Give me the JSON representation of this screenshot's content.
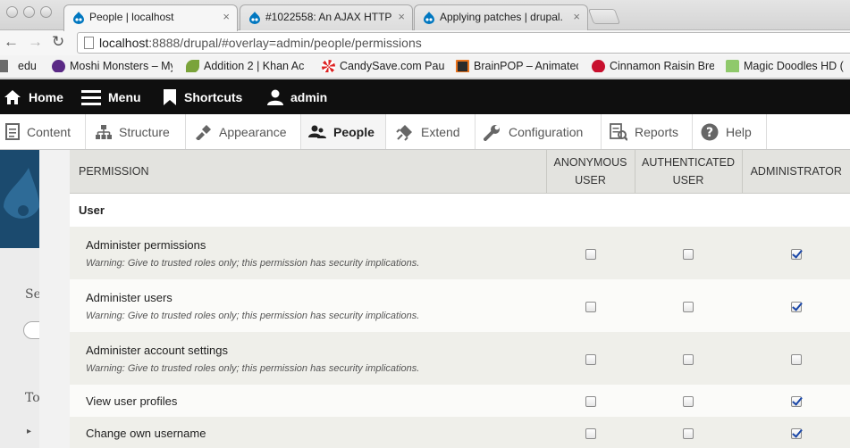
{
  "browser": {
    "tabs": [
      {
        "label": "People | localhost",
        "close": "×",
        "active": true
      },
      {
        "label": "#1022558: An AJAX HTTP",
        "close": "×",
        "active": false
      },
      {
        "label": "Applying patches | drupal.",
        "close": "×",
        "active": false
      }
    ],
    "url_host": "localhost",
    "url_rest": ":8888/drupal/#overlay=admin/people/permissions",
    "bookmarks": [
      {
        "label": "edu",
        "icon": "folder-icon"
      },
      {
        "label": "Moshi Monsters – My",
        "icon": "moshi-icon"
      },
      {
        "label": "Addition 2 | Khan Ac",
        "icon": "leaf-icon"
      },
      {
        "label": "CandySave.com Paul",
        "icon": "candy-icon"
      },
      {
        "label": "BrainPOP – Animated",
        "icon": "brainpop-icon"
      },
      {
        "label": "Cinnamon Raisin Bre",
        "icon": "food-icon"
      },
      {
        "label": "Magic Doodles HD (",
        "icon": "doodle-icon"
      }
    ]
  },
  "drupal_toolbar": {
    "home": "Home",
    "menu": "Menu",
    "shortcuts": "Shortcuts",
    "user": "admin"
  },
  "tray": [
    {
      "label": "Content",
      "icon": "content-icon"
    },
    {
      "label": "Structure",
      "icon": "structure-icon"
    },
    {
      "label": "Appearance",
      "icon": "appearance-icon"
    },
    {
      "label": "People",
      "icon": "people-icon",
      "active": true
    },
    {
      "label": "Extend",
      "icon": "extend-icon"
    },
    {
      "label": "Configuration",
      "icon": "wrench-icon"
    },
    {
      "label": "Reports",
      "icon": "reports-icon"
    },
    {
      "label": "Help",
      "icon": "help-icon"
    }
  ],
  "background": {
    "text1": "Se",
    "text2": "To"
  },
  "permissions": {
    "headers": {
      "permission": "PERMISSION",
      "anonymous_1": "ANONYMOUS",
      "anonymous_2": "USER",
      "authenticated_1": "AUTHENTICATED",
      "authenticated_2": "USER",
      "administrator": "ADMINISTRATOR"
    },
    "group": "User",
    "rows": [
      {
        "title": "Administer permissions",
        "warning": "Warning: Give to trusted roles only; this permission has security implications.",
        "anonymous": false,
        "authenticated": false,
        "administrator": true
      },
      {
        "title": "Administer users",
        "warning": "Warning: Give to trusted roles only; this permission has security implications.",
        "anonymous": false,
        "authenticated": false,
        "administrator": true
      },
      {
        "title": "Administer account settings",
        "warning": "Warning: Give to trusted roles only; this permission has security implications.",
        "anonymous": false,
        "authenticated": false,
        "administrator": false
      },
      {
        "title": "View user profiles",
        "warning": "",
        "anonymous": false,
        "authenticated": false,
        "administrator": true
      },
      {
        "title": "Change own username",
        "warning": "",
        "anonymous": false,
        "authenticated": false,
        "administrator": true
      }
    ]
  }
}
